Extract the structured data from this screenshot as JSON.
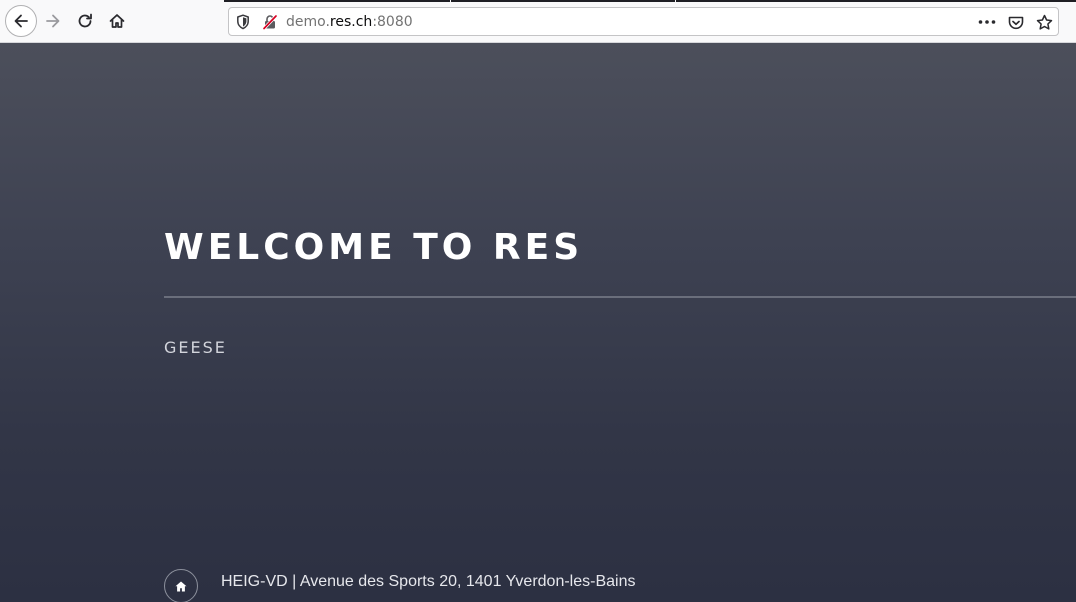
{
  "browser": {
    "url_prefix": "demo.",
    "url_host": "res.ch",
    "url_suffix": ":8080",
    "icons": [
      "back-arrow-icon",
      "forward-arrow-icon",
      "reload-icon",
      "home-icon",
      "shield-icon",
      "insecure-lock-icon",
      "more-actions-icon",
      "pocket-icon",
      "bookmark-star-icon"
    ]
  },
  "page": {
    "title": "WELCOME TO RES",
    "subtitle": "GEESE",
    "footer": {
      "icon": "home-icon",
      "text": "HEIG-VD | Avenue des Sports 20, 1401 Yverdon-les-Bains"
    }
  },
  "colors": {
    "background_top": "#4c4f5b",
    "background_bottom": "#2c3042",
    "title": "#ffffff",
    "rule": "#6a6e7b"
  }
}
